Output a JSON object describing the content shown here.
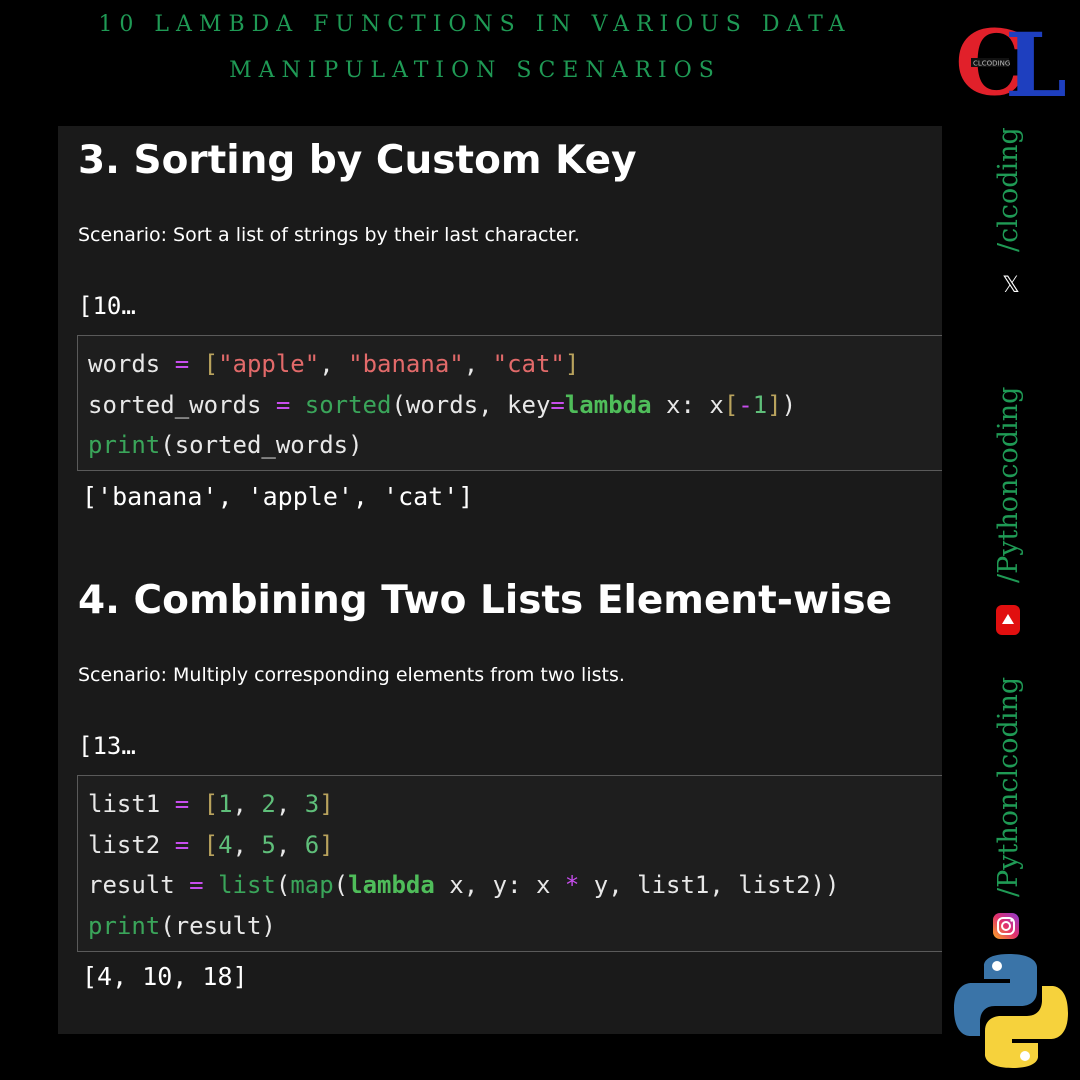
{
  "header": {
    "title_line1": "10 LAMBDA FUNCTIONS IN VARIOUS DATA",
    "title_line2": "MANIPULATION SCENARIOS"
  },
  "logo": {
    "letters": "CL",
    "small_text": "CLCODING"
  },
  "sections": [
    {
      "heading": "3. Sorting by Custom Key",
      "scenario": "Scenario: Sort a list of strings by their last character.",
      "prompt": "[10…",
      "output": "['banana', 'apple', 'cat']"
    },
    {
      "heading": "4. Combining Two Lists Element-wise",
      "scenario": "Scenario: Multiply corresponding elements from two lists.",
      "prompt": "[13…",
      "output": "[4, 10, 18]"
    }
  ],
  "code": {
    "s3": {
      "l1": [
        "words",
        " = ",
        "[",
        "\"apple\"",
        ", ",
        "\"banana\"",
        ", ",
        "\"cat\"",
        "]"
      ],
      "l2": [
        "sorted_words",
        " = ",
        "sorted",
        "(words, key",
        "=",
        "lambda",
        " x: x",
        "[",
        "-",
        "1",
        "]",
        ")"
      ],
      "l3": [
        "print",
        "(sorted_words)"
      ]
    },
    "s4": {
      "l1": [
        "list1",
        " = ",
        "[",
        "1",
        ", ",
        "2",
        ", ",
        "3",
        "]"
      ],
      "l2": [
        "list2",
        " = ",
        "[",
        "4",
        ", ",
        "5",
        ", ",
        "6",
        "]"
      ],
      "l3": [
        "result",
        " = ",
        "list",
        "(",
        "map",
        "(",
        "lambda",
        " x, y: x ",
        "*",
        " y, list1, list2))"
      ],
      "l4": [
        "print",
        "(result)"
      ]
    }
  },
  "sidebar": {
    "handles": [
      "/clcoding",
      "/Pythoncoding",
      "/Pythonclcoding"
    ],
    "icons": [
      "x-icon",
      "youtube-icon",
      "instagram-icon",
      "python-logo"
    ],
    "x_glyph": "𝕏"
  },
  "colors": {
    "accent": "#1f9a55",
    "operator": "#c74ded",
    "string": "#e26a6a",
    "builtin": "#3aa55a",
    "keyword": "#4fbd5a",
    "bracket": "#b9a35d"
  }
}
